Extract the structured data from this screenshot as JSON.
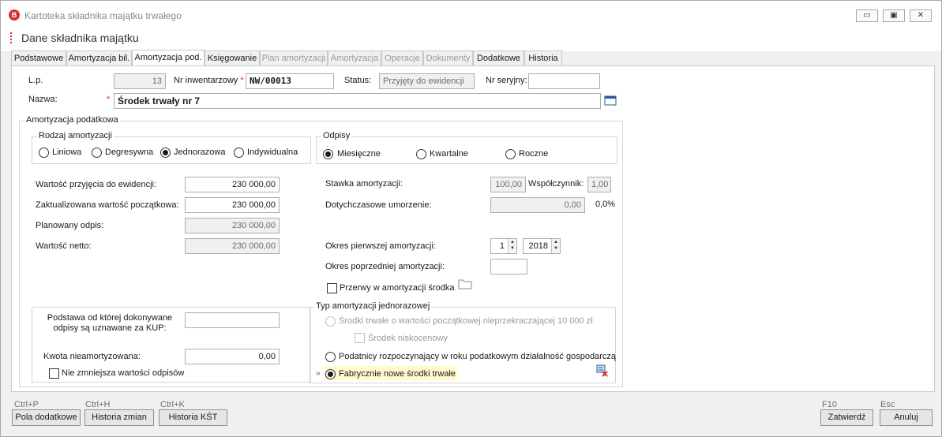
{
  "window": {
    "title": "Kartoteka składnika majątku trwałego",
    "logo_letter": "B",
    "minimize_glyph": "▭",
    "maximize_glyph": "▣",
    "close_glyph": "✕"
  },
  "header": {
    "title": "Dane składnika majątku"
  },
  "tabs": [
    {
      "label": "Podstawowe",
      "state": "enabled"
    },
    {
      "label": "Amortyzacja bil.",
      "state": "enabled"
    },
    {
      "label": "Amortyzacja pod.",
      "state": "active"
    },
    {
      "label": "Księgowanie",
      "state": "enabled"
    },
    {
      "label": "Plan amortyzacji",
      "state": "disabled"
    },
    {
      "label": "Amortyzacja",
      "state": "disabled"
    },
    {
      "label": "Operacje",
      "state": "disabled"
    },
    {
      "label": "Dokumenty",
      "state": "disabled"
    },
    {
      "label": "Dodatkowe",
      "state": "enabled"
    },
    {
      "label": "Historia",
      "state": "enabled"
    }
  ],
  "form": {
    "lp_label": "L.p.",
    "lp_value": "13",
    "nr_inw_label": "Nr inwentarzowy",
    "nr_inw_value": "NW/00013",
    "status_label": "Status:",
    "status_value": "Przyjęty do ewidencji",
    "nr_ser_label": "Nr seryjny:",
    "nr_ser_value": "",
    "nazwa_label": "Nazwa:",
    "nazwa_value": "Środek trwały nr 7",
    "required_mark": "*"
  },
  "amort": {
    "group_title": "Amortyzacja podatkowa",
    "rodzaj_title": "Rodzaj amortyzacji",
    "rodzaj_options": [
      "Liniowa",
      "Degresywna",
      "Jednorazowa",
      "Indywidualna"
    ],
    "rodzaj_selected": "Jednorazowa",
    "odpisy_title": "Odpisy",
    "odpisy_options": [
      "Miesięczne",
      "Kwartalne",
      "Roczne"
    ],
    "odpisy_selected": "Miesięczne",
    "wartosc_przyjecia_label": "Wartość przyjęcia do ewidencji:",
    "wartosc_przyjecia_value": "230 000,00",
    "zaktualizowana_label": "Zaktualizowana wartość początkowa:",
    "zaktualizowana_value": "230 000,00",
    "planowany_label": "Planowany odpis:",
    "planowany_value": "230 000,00",
    "netto_label": "Wartość netto:",
    "netto_value": "230 000,00",
    "stawka_label": "Stawka amortyzacji:",
    "stawka_value": "100,00",
    "wspolczynnik_label": "Współczynnik:",
    "wspolczynnik_value": "1,00",
    "umorzenie_label": "Dotychczasowe umorzenie:",
    "umorzenie_value": "0,00",
    "umorzenie_pct": "0,0%",
    "okres_pierwszej_label": "Okres pierwszej amortyzacji:",
    "okres_month": "1",
    "okres_year": "2018",
    "okres_poprzedniej_label": "Okres poprzedniej amortyzacji:",
    "okres_poprzedniej_value": "",
    "przerwy_label": "Przerwy w amortyzacji środka",
    "spin_up": "▲",
    "spin_down": "▼"
  },
  "kup": {
    "podstawa_label": "Podstawa od której dokonywane odpisy są uznawane za KUP:",
    "podstawa_value": "",
    "kwota_label": "Kwota nieamortyzowana:",
    "kwota_value": "0,00",
    "nie_zmniejsza_label": "Nie zmniejsza wartości odpisów"
  },
  "typ": {
    "title": "Typ amortyzacji jednorazowej",
    "option1": "Środki trwałe o wartości początkowej nieprzekraczającej 10 000 zł",
    "niskocenowy": "Środek niskocenowy",
    "option2": "Podatnicy rozpoczynający w roku podatkowym działalność gospodarczą",
    "option3": "Fabrycznie nowe środki trwałe",
    "selected": "option3",
    "row_marker": "»"
  },
  "footer": {
    "buttons": [
      {
        "hotkey": "Ctrl+P",
        "label": "Pola dodatkowe"
      },
      {
        "hotkey": "Ctrl+H",
        "label": "Historia zmian"
      },
      {
        "hotkey": "Ctrl+K",
        "label": "Historia KŚT"
      }
    ],
    "confirm_hotkey": "F10",
    "confirm_label": "Zatwierdź",
    "cancel_hotkey": "Esc",
    "cancel_label": "Anuluj"
  }
}
